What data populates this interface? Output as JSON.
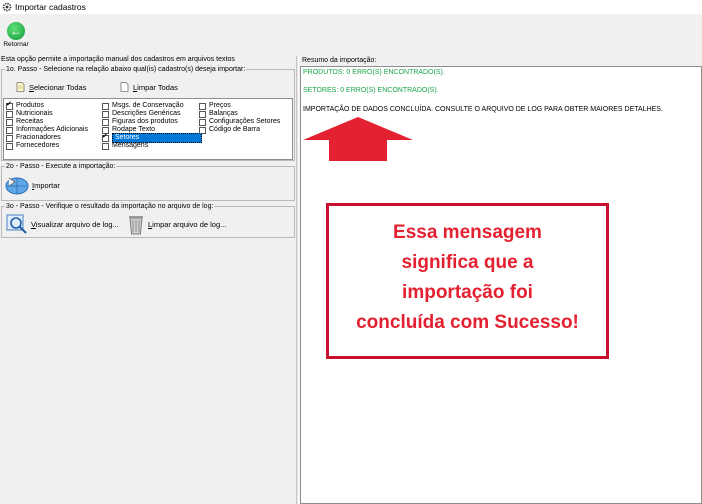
{
  "window": {
    "title": "Importar cadastros"
  },
  "toolbar": {
    "back_label": "Retornar"
  },
  "left": {
    "intro": "Esta opção permite a importação manual dos cadastros em arquivos textos",
    "step1_label": "1o. Passo - Selecione na relação abaixo qual(is) cadastro(s) deseja importar:",
    "select_all_prefix": "S",
    "select_all_rest": "elecionar Todas",
    "clear_all_prefix": "L",
    "clear_all_rest": "impar Todas",
    "items": [
      {
        "label": "Produtos",
        "checked": true
      },
      {
        "label": "Nutricionais",
        "checked": false
      },
      {
        "label": "Receitas",
        "checked": false
      },
      {
        "label": "Informações Adicionais",
        "checked": false
      },
      {
        "label": "Fracionadores",
        "checked": false
      },
      {
        "label": "Fornecedores",
        "checked": false
      },
      {
        "label": "Msgs. de Conservação",
        "checked": false
      },
      {
        "label": "Descrições Genéricas",
        "checked": false
      },
      {
        "label": "Figuras dos produtos",
        "checked": false
      },
      {
        "label": "Rodape Texto",
        "checked": false
      },
      {
        "label": "Setores",
        "checked": true
      },
      {
        "label": "Mensagens",
        "checked": false
      },
      {
        "label": "Preços",
        "checked": false
      },
      {
        "label": "Balanças",
        "checked": false
      },
      {
        "label": "Configurações Setores",
        "checked": false
      },
      {
        "label": "Código de Barra",
        "checked": false
      }
    ],
    "step2_label": "2o - Passo - Execute a importação:",
    "import_prefix": "I",
    "import_rest": "mportar",
    "step3_label": "3o - Passo - Verifique o resultado da importação no arquivo de log:",
    "view_log_prefix": "V",
    "view_log_rest": "isualizar arquivo de log...",
    "clear_log_prefix": "L",
    "clear_log_rest": "impar arquivo de log..."
  },
  "right": {
    "label": "Resumo da importação:",
    "messages": [
      "PRODUTOS: 0 ERRO(S) ENCONTRADO(S).",
      "SETORES: 0 ERRO(S) ENCONTRADO(S).",
      "IMPORTAÇÃO DE DADOS CONCLUÍDA. CONSULTE O ARQUIVO DE LOG PARA OBTER MAIORES DETALHES."
    ]
  },
  "annotation": {
    "lines": [
      "Essa mensagem",
      "significa que a",
      "importação foi",
      "concluída com Sucesso!"
    ]
  },
  "colors": {
    "accent_red": "#e42130",
    "success_green": "#1aa34a",
    "selection_blue": "#0078d7"
  }
}
